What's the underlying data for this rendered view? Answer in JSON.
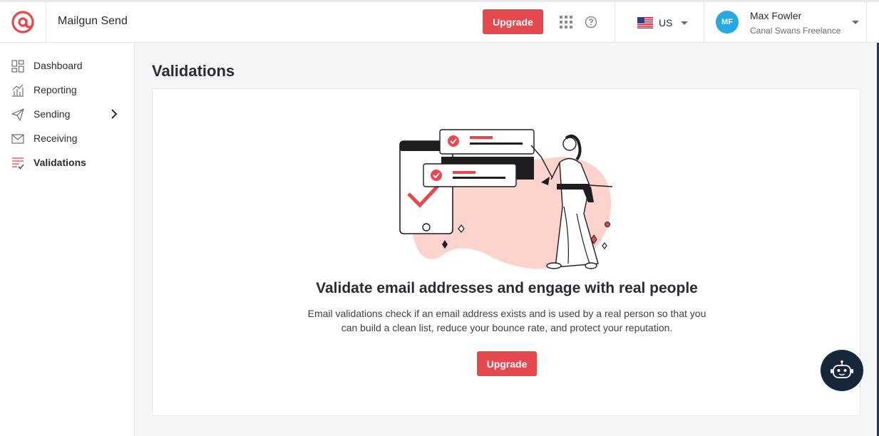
{
  "header": {
    "app_name": "Mailgun Send",
    "upgrade_label": "Upgrade",
    "region_label": "US",
    "user": {
      "initials": "MF",
      "name": "Max Fowler",
      "company": "Canal Swans Freelance"
    }
  },
  "sidebar": {
    "items": [
      {
        "label": "Dashboard",
        "icon": "dashboard-icon"
      },
      {
        "label": "Reporting",
        "icon": "reporting-icon"
      },
      {
        "label": "Sending",
        "icon": "sending-icon",
        "has_submenu": true
      },
      {
        "label": "Receiving",
        "icon": "receiving-icon"
      },
      {
        "label": "Validations",
        "icon": "validations-icon",
        "active": true
      }
    ]
  },
  "main": {
    "page_title": "Validations",
    "headline": "Validate email addresses and engage with real people",
    "description": "Email validations check if an email address exists and is used by a real person so that you can build a clean list, reduce your bounce rate, and protect your reputation.",
    "upgrade_label": "Upgrade"
  },
  "colors": {
    "accent": "#e5484d",
    "avatar": "#26a9e0",
    "chatbot": "#16273a",
    "illustration_blob": "#fcd4cd"
  }
}
